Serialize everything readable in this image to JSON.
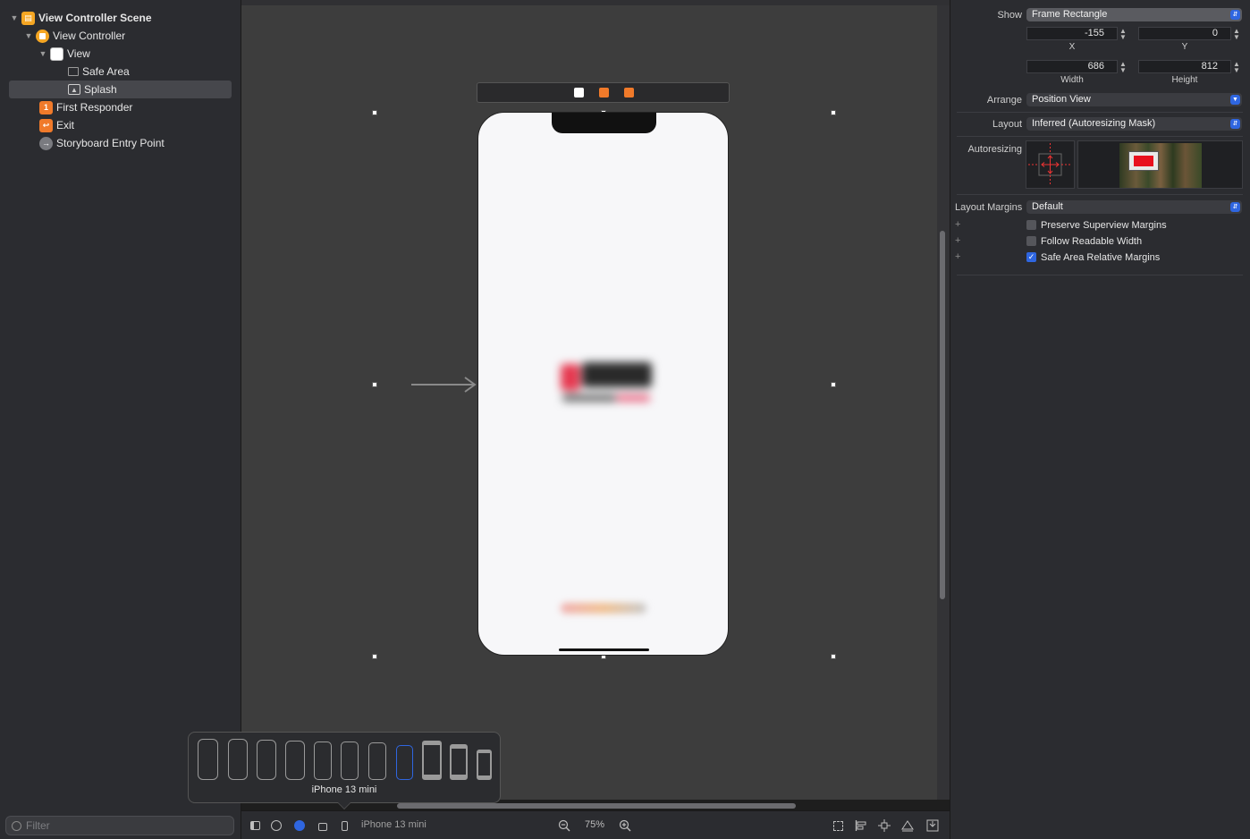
{
  "outline": {
    "items": [
      {
        "label": "View Controller Scene",
        "level": 0,
        "icon": "scene-icon",
        "bold": true,
        "expanded": true
      },
      {
        "label": "View Controller",
        "level": 1,
        "icon": "view-controller-icon",
        "expanded": true
      },
      {
        "label": "View",
        "level": 2,
        "icon": "view-icon",
        "expanded": true
      },
      {
        "label": "Safe Area",
        "level": 3,
        "icon": "safe-area-icon"
      },
      {
        "label": "Splash",
        "level": 3,
        "icon": "image-view-icon",
        "selected": true
      },
      {
        "label": "First Responder",
        "level": 1,
        "icon": "first-responder-icon"
      },
      {
        "label": "Exit",
        "level": 1,
        "icon": "exit-icon"
      },
      {
        "label": "Storyboard Entry Point",
        "level": 1,
        "icon": "entry-point-icon"
      }
    ],
    "filter_placeholder": "Filter"
  },
  "canvas": {
    "device_name": "iPhone 13 mini",
    "zoom": "75%"
  },
  "device_popover": {
    "selected_label": "iPhone 13 mini",
    "device_count": 11,
    "selected_index": 7
  },
  "inspector": {
    "show_label": "Show",
    "show_value": "Frame Rectangle",
    "x_value": "-155",
    "y_value": "0",
    "x_caption": "X",
    "y_caption": "Y",
    "width_value": "686",
    "height_value": "812",
    "width_caption": "Width",
    "height_caption": "Height",
    "arrange_label": "Arrange",
    "arrange_value": "Position View",
    "layout_label": "Layout",
    "layout_value": "Inferred (Autoresizing Mask)",
    "autoresizing_label": "Autoresizing",
    "layout_margins_label": "Layout Margins",
    "layout_margins_value": "Default",
    "checkboxes": [
      {
        "label": "Preserve Superview Margins",
        "checked": false
      },
      {
        "label": "Follow Readable Width",
        "checked": false
      },
      {
        "label": "Safe Area Relative Margins",
        "checked": true
      }
    ]
  },
  "colors": {
    "accent": "#2f66e0",
    "scene_icon": "#f5a623",
    "first_responder": "#f07a2a",
    "exit": "#f07a2a"
  }
}
